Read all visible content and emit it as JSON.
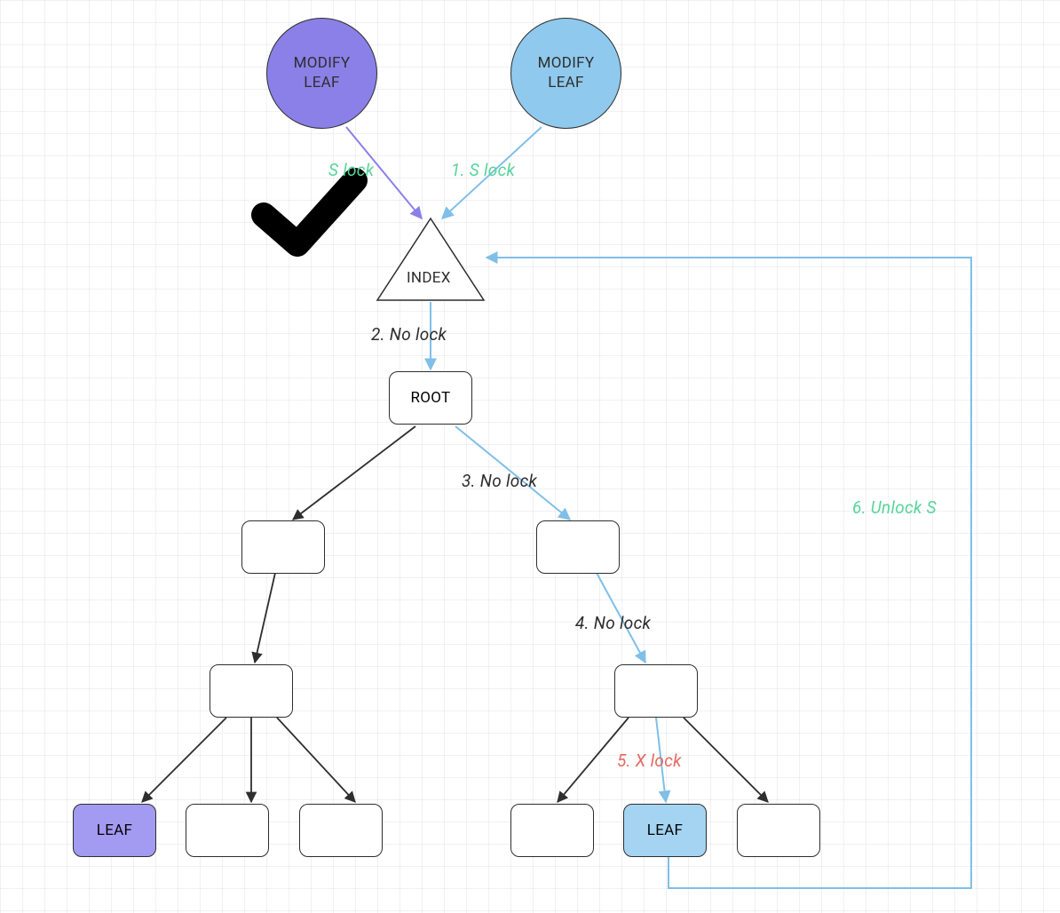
{
  "shapes": {
    "modify_leaf_purple": "MODIFY\nLEAF",
    "modify_leaf_blue": "MODIFY\nLEAF",
    "index": "INDEX",
    "root": "ROOT",
    "leaf_purple": "LEAF",
    "leaf_blue": "LEAF"
  },
  "edge_labels": {
    "s_lock_left": "S lock",
    "s_lock_right": "1. S lock",
    "no_lock_2": "2. No lock",
    "no_lock_3": "3. No lock",
    "no_lock_4": "4. No lock",
    "x_lock_5": "5. X lock",
    "unlock_s_6": "6. Unlock S"
  },
  "colors": {
    "purple_fill": "#8a80e8",
    "blue_fill": "#8fc9ed",
    "leaf_purple_fill": "#a39af1",
    "leaf_blue_fill": "#a5d4f2",
    "blue_stroke": "#7fbfe8",
    "purple_stroke": "#8a80e8",
    "dark_stroke": "#2e2e2e",
    "green_text": "#58d49a",
    "red_text": "#e6675e"
  }
}
